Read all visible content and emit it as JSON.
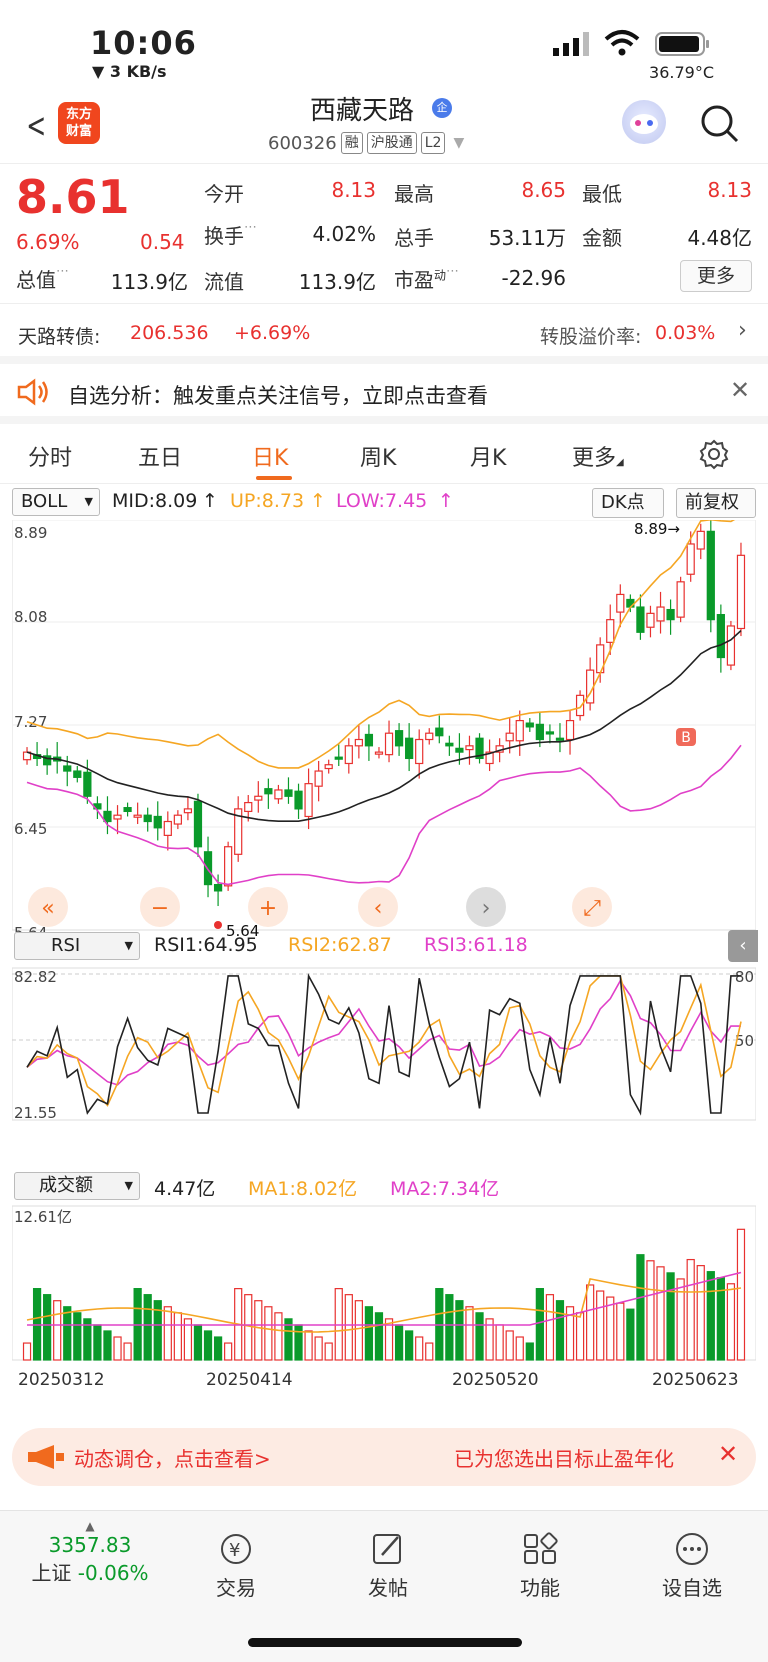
{
  "status": {
    "time": "10:06",
    "speed": "▼ 3 KB/s",
    "temp": "36.79°C"
  },
  "nav": {
    "logo_line1": "东方",
    "logo_line2": "财富",
    "name": "西藏天路",
    "badge": "企",
    "code": "600326",
    "tags": [
      "融",
      "沪股通",
      "L2"
    ]
  },
  "quote": {
    "price": "8.61",
    "pct": "6.69%",
    "change": "0.54",
    "open_label": "今开",
    "open": "8.13",
    "high_label": "最高",
    "high": "8.65",
    "low_label": "最低",
    "low": "8.13",
    "turnover_label": "换手",
    "turnover": "4.02%",
    "volume_label": "总手",
    "volume": "53.11万",
    "amount_label": "金额",
    "amount": "4.48亿",
    "mcap_label": "总值",
    "mcap": "113.9亿",
    "float_label": "流值",
    "float": "113.9亿",
    "pe_label": "市盈",
    "pe_sup": "动",
    "pe": "-22.96",
    "more_label": "更多"
  },
  "bond": {
    "label": "天路转债:",
    "price": "206.536",
    "pct": "+6.69%",
    "premium_label": "转股溢价率:",
    "premium": "0.03%"
  },
  "notice": {
    "text": "自选分析：触发重点关注信号，立即点击查看"
  },
  "tabs": [
    "分时",
    "五日",
    "日K",
    "周K",
    "月K",
    "更多"
  ],
  "active_tab": 2,
  "kline": {
    "indicator": "BOLL",
    "mid": "MID:8.09",
    "up": "UP:8.73",
    "low": "LOW:7.45",
    "dk_label": "DK点",
    "adj_label": "前复权",
    "axis": [
      "8.89",
      "8.08",
      "7.27",
      "6.45",
      "5.64"
    ],
    "max_label": "8.89→",
    "min_label": "5.64",
    "b_marker": "B"
  },
  "rsi": {
    "indicator": "RSI",
    "rsi1": "RSI1:64.95",
    "rsi2": "RSI2:62.87",
    "rsi3": "RSI3:61.18",
    "axis_top": "82.82",
    "axis_bottom": "21.55",
    "right_top": "80",
    "right_mid": "50"
  },
  "vol": {
    "indicator": "成交额",
    "value": "4.47亿",
    "ma1": "MA1:8.02亿",
    "ma2": "MA2:7.34亿",
    "axis_top": "12.61亿"
  },
  "dates": [
    "20250312",
    "20250414",
    "20250520",
    "20250623"
  ],
  "banner": {
    "left": "动态调仓，点击查看>",
    "right": "已为您选出目标止盈年化"
  },
  "bottom": {
    "index_value": "3357.83",
    "index_name": "上证",
    "index_pct": "-0.06%",
    "trade": "交易",
    "post": "发帖",
    "func": "功能",
    "watch": "设自选"
  },
  "colors": {
    "up": "#e8312f",
    "down": "#0a9a2a",
    "mid": "#222222",
    "upper": "#f5a623",
    "lower": "#e040c8",
    "accent": "#f06a1e"
  }
}
